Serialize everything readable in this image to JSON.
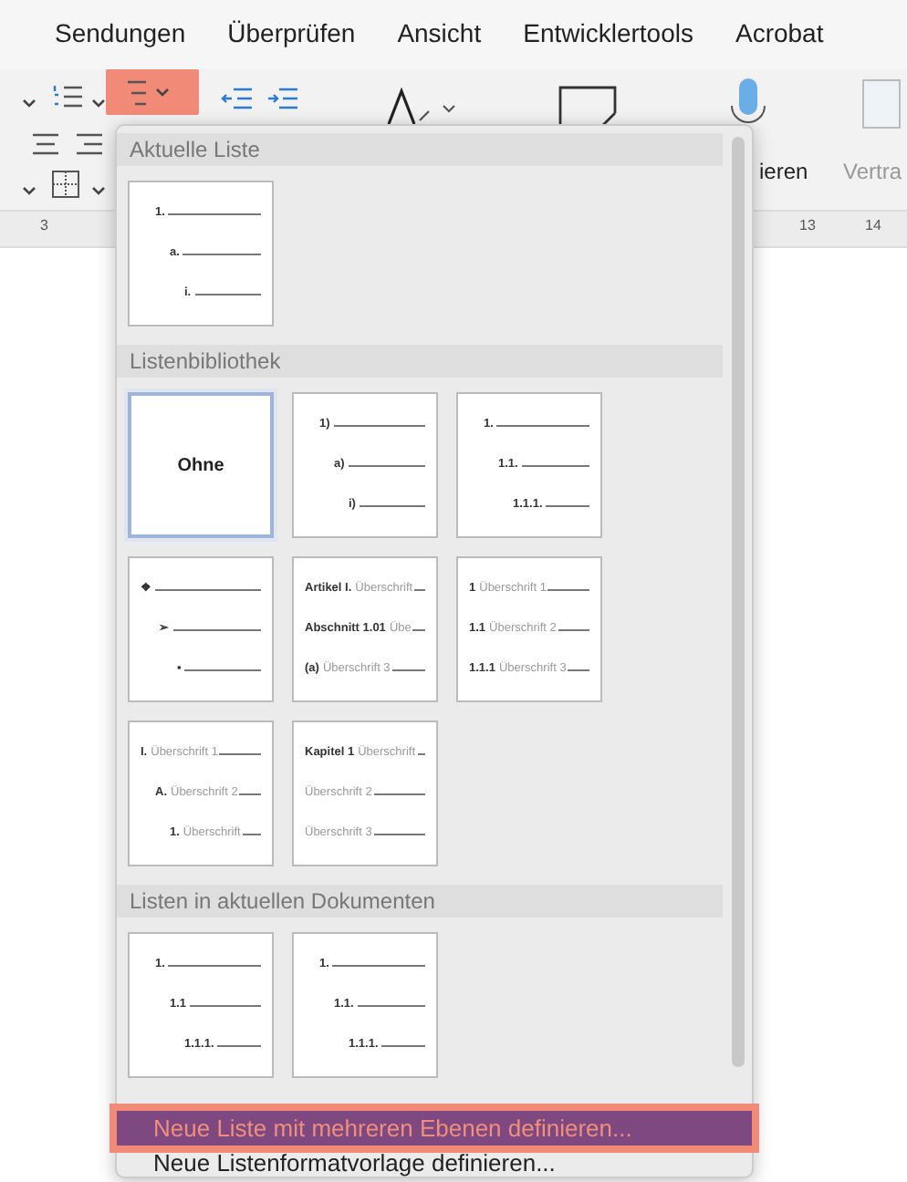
{
  "ribbon_tabs": [
    "Sendungen",
    "Überprüfen",
    "Ansicht",
    "Entwicklertools",
    "Acrobat"
  ],
  "toolbar": {
    "multilevel_highlighted": true,
    "cut_labels": [
      "ieren",
      "Vertra"
    ]
  },
  "ruler": {
    "labels": [
      "3",
      "13",
      "14"
    ]
  },
  "menu": {
    "sections": [
      {
        "title": "Aktuelle Liste",
        "tiles": [
          {
            "kind": "stepped",
            "selected": false,
            "lines": [
              {
                "label": "1."
              },
              {
                "label": "a."
              },
              {
                "label": "i."
              }
            ]
          }
        ]
      },
      {
        "title": "Listenbibliothek",
        "tiles": [
          {
            "kind": "none",
            "selected": true,
            "caption": "Ohne"
          },
          {
            "kind": "stepped",
            "selected": false,
            "lines": [
              {
                "label": "1)"
              },
              {
                "label": "a)"
              },
              {
                "label": "i)"
              }
            ]
          },
          {
            "kind": "stepped",
            "selected": false,
            "lines": [
              {
                "label": "1."
              },
              {
                "label": "1.1."
              },
              {
                "label": "1.1.1."
              }
            ]
          },
          {
            "kind": "bullets",
            "selected": false,
            "lines": [
              {
                "label": "❖"
              },
              {
                "label": "➢"
              },
              {
                "label": "▪"
              }
            ]
          },
          {
            "kind": "flat",
            "selected": false,
            "lines": [
              {
                "label": "Artikel I.",
                "text": "Überschrift"
              },
              {
                "label": "Abschnitt 1.01",
                "text": "Übe"
              },
              {
                "label": "(a)",
                "text": "Überschrift 3"
              }
            ]
          },
          {
            "kind": "flat",
            "selected": false,
            "lines": [
              {
                "label": "1",
                "text": "Überschrift 1"
              },
              {
                "label": "1.1",
                "text": "Überschrift 2"
              },
              {
                "label": "1.1.1",
                "text": "Überschrift 3"
              }
            ]
          },
          {
            "kind": "stepped",
            "selected": false,
            "lines": [
              {
                "label": "I.",
                "text": "Überschrift 1"
              },
              {
                "label": "A.",
                "text": "Überschrift 2"
              },
              {
                "label": "1.",
                "text": "Überschrift"
              }
            ]
          },
          {
            "kind": "flat",
            "selected": false,
            "lines": [
              {
                "label": "Kapitel 1",
                "text": "Überschrift"
              },
              {
                "text": "Überschrift 2"
              },
              {
                "text": "Überschrift 3"
              }
            ]
          }
        ]
      },
      {
        "title": "Listen in aktuellen Dokumenten",
        "tiles": [
          {
            "kind": "stepped",
            "selected": false,
            "lines": [
              {
                "label": "1."
              },
              {
                "label": "1.1"
              },
              {
                "label": "1.1.1."
              }
            ]
          },
          {
            "kind": "stepped",
            "selected": false,
            "lines": [
              {
                "label": "1."
              },
              {
                "label": "1.1."
              },
              {
                "label": "1.1.1."
              }
            ]
          }
        ]
      }
    ],
    "items": [
      {
        "label": "Neue Liste mit mehreren Ebenen definieren...",
        "selected": true
      },
      {
        "label": "Neue Listenformatvorlage definieren...",
        "selected": false
      }
    ]
  }
}
